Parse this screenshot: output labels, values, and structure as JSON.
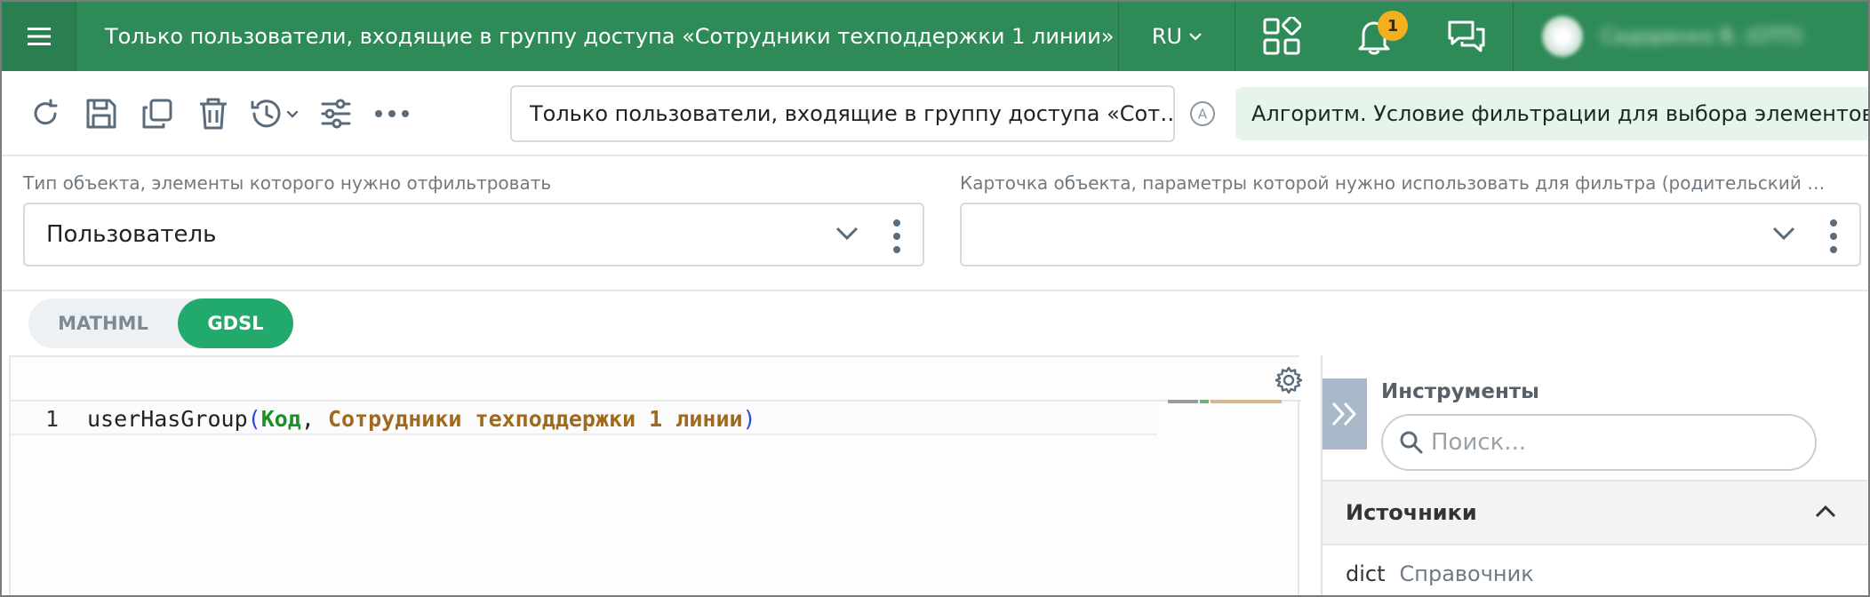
{
  "header": {
    "title": "Только пользователи, входящие в группу доступа «Сотрудники техподдержки 1 линии»",
    "language": "RU",
    "notifications_count": "1",
    "user_name": "Сидоренко В. (ОТП)",
    "colors": {
      "bar": "#2e8b57",
      "badge": "#f2b01e"
    }
  },
  "toolbar": {
    "icons": [
      "refresh-icon",
      "save-icon",
      "copy-icon",
      "delete-icon",
      "history-icon",
      "settings-sliders-icon",
      "more-icon"
    ],
    "name_value": "Только пользователи, входящие в группу доступа «Сот…",
    "type_chip": "Алгоритм. Условие фильтрации для выбора элементов"
  },
  "fields": {
    "object_type": {
      "label": "Тип объекта, элементы которого нужно отфильтровать",
      "value": "Пользователь"
    },
    "parent_card": {
      "label": "Карточка объекта, параметры которой нужно использовать для фильтра (родительский …",
      "value": ""
    }
  },
  "mode_toggle": {
    "options": [
      "MATHML",
      "GDSL"
    ],
    "selected": "GDSL",
    "accent": "#22aa6d"
  },
  "editor": {
    "lines": [
      {
        "number": "1",
        "fn": "userHasGroup",
        "open": "(",
        "arg1": "Код",
        "comma": ", ",
        "arg2": "Сотрудники техподдержки 1 линии",
        "close": ")"
      }
    ]
  },
  "tools": {
    "title": "Инструменты",
    "search_placeholder": "Поиск...",
    "sources_title": "Источники",
    "sources": [
      {
        "key": "dict",
        "label": "Справочник"
      }
    ]
  }
}
